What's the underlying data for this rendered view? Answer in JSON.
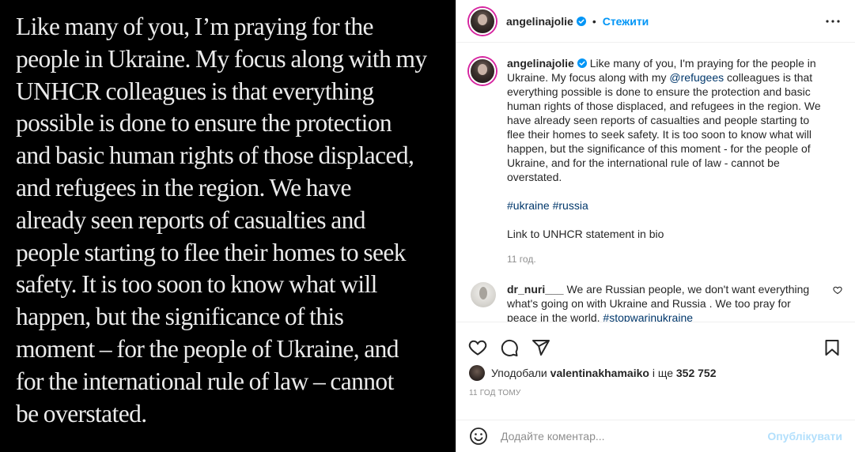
{
  "media": {
    "lines": [
      "Like many of you, I’m praying for the",
      "people in Ukraine. My focus along with my",
      "UNHCR colleagues is that everything",
      "possible is done to ensure the protection",
      "and basic human rights of those displaced,",
      "and refugees in the region. We have",
      "already seen reports of casualties and",
      "people starting to flee their homes to seek",
      "safety. It is too soon to know what will",
      "happen, but the significance of this",
      "moment – for the people of Ukraine, and",
      "for the international rule of law – cannot",
      "be overstated."
    ]
  },
  "header": {
    "username": "angelinajolie",
    "separator": "•",
    "follow_label": "Стежити"
  },
  "caption": {
    "username": "angelinajolie",
    "text_before_mention": "Like many of you, I'm praying for the people in Ukraine. My focus along with my ",
    "mention": "@refugees",
    "text_after_mention": " colleagues is that everything possible is done to ensure the protection and basic human rights of those displaced, and refugees in the region. We have already seen reports of casualties and people starting to flee their homes to seek safety. It is too soon to know what will happen, but the significance of this moment - for the people of Ukraine, and for the international rule of law - cannot be overstated.",
    "hashtag1": "#ukraine",
    "hashtag2": "#russia",
    "link_note": "Link to UNHCR statement in bio",
    "time": "11 год."
  },
  "comment": {
    "username": "dr_nuri___",
    "text": " We are Russian people, we don't want everything what's going on with Ukraine and Russia . We too pray for peace in the world. ",
    "hashtag": "#stopwarinukraine"
  },
  "likes": {
    "prefix": "Уподобали",
    "user": "valentinakhamaiko",
    "middle": "і ще",
    "count": "352 752"
  },
  "post_time": "11 ГОД ТОМУ",
  "add_comment": {
    "placeholder": "Додайте коментар...",
    "publish_label": "Опублікувати"
  },
  "colors": {
    "accent": "#0095f6",
    "link": "#00376b",
    "muted": "#8e8e8e",
    "publish_disabled": "#b2dffc"
  }
}
